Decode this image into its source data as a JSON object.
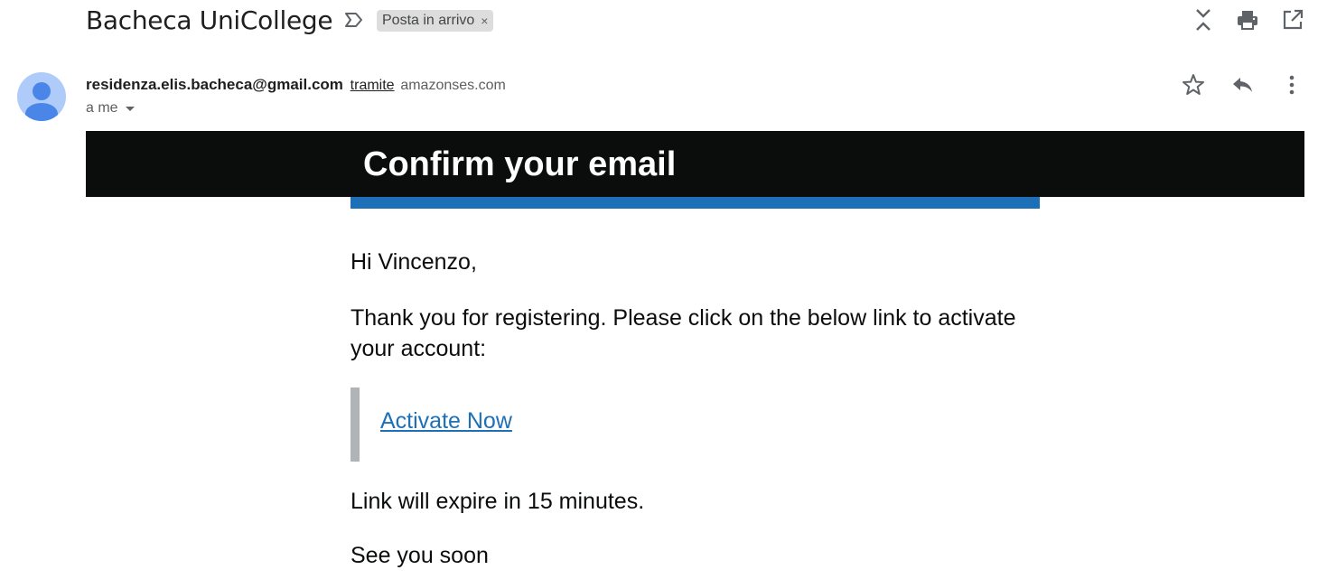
{
  "email": {
    "subject": "Bacheca UniCollege",
    "label": "Posta in arrivo",
    "label_remove": "×",
    "sender_email": "residenza.elis.bacheca@gmail.com",
    "via_text": "tramite",
    "via_domain": "amazonses.com",
    "recipient_text": "a me"
  },
  "body": {
    "banner_title": "Confirm your email",
    "greeting": "Hi Vincenzo,",
    "message": "Thank you for registering. Please click on the below link to activate your account:",
    "link_text": "Activate Now",
    "expiry_note": "Link will expire in 15 minutes.",
    "sign_off": "See you soon"
  },
  "icons": {
    "importance": "importance-marker-icon",
    "collapse": "collapse-all-icon",
    "print": "print-icon",
    "open_new_window": "open-in-new-window-icon",
    "avatar": "person-avatar-icon",
    "star": "star-icon",
    "reply": "reply-icon",
    "more": "more-vert-icon"
  },
  "colors": {
    "banner_bg": "#0b0c0c",
    "accent_blue": "#1d70b8",
    "link_color": "#1d70b8",
    "avatar_bg": "#aecbfa",
    "avatar_fg": "#4a86e8",
    "inset_bar": "#b1b4b6"
  }
}
